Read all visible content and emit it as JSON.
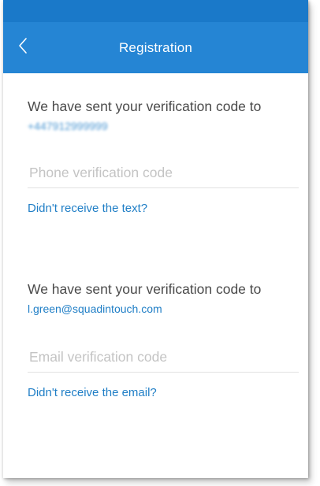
{
  "header": {
    "title": "Registration",
    "back_icon": "chevron-left-icon"
  },
  "phone_section": {
    "message": "We have sent your verification code to",
    "phone_number": "+447912999999",
    "placeholder": "Phone verification code",
    "resend_link": "Didn't receive the text?"
  },
  "email_section": {
    "message": "We have sent your verification code to",
    "email": "l.green@squadintouch.com",
    "placeholder": "Email verification code",
    "resend_link": "Didn't receive the email?"
  },
  "colors": {
    "accent": "#2585d4",
    "status_bar": "#1a79c9",
    "link": "#1f7ec6"
  }
}
